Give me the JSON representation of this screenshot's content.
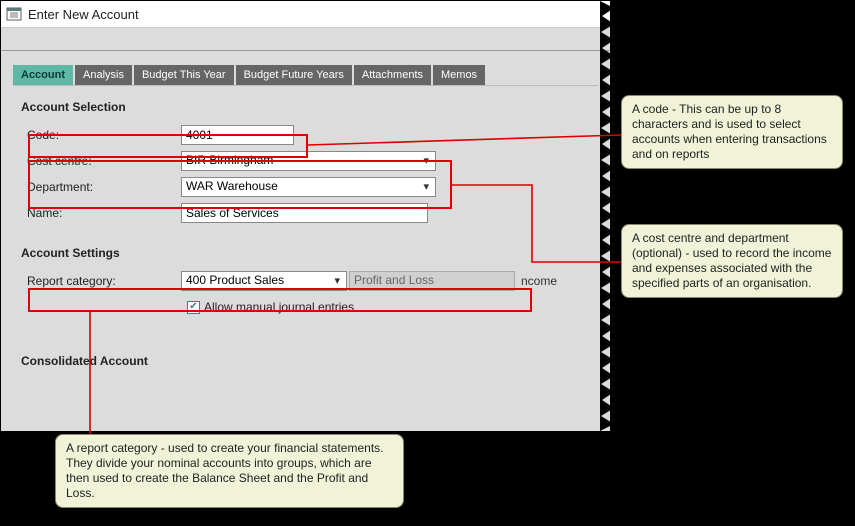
{
  "window": {
    "title": "Enter New Account"
  },
  "tabs": {
    "account": "Account",
    "analysis": "Analysis",
    "budget_this_year": "Budget This Year",
    "budget_future_years": "Budget Future Years",
    "attachments": "Attachments",
    "memos": "Memos"
  },
  "sections": {
    "selection": "Account Selection",
    "settings": "Account Settings",
    "consolidated": "Consolidated Account"
  },
  "labels": {
    "code": "Code:",
    "cost_centre": "Cost centre:",
    "department": "Department:",
    "name": "Name:",
    "report_category": "Report category:",
    "allow_manual": "Allow manual journal entries"
  },
  "values": {
    "code": "4001",
    "cost_centre": "BIR Birmingham",
    "department": "WAR Warehouse",
    "name": "Sales of Services",
    "report_category": "400 Product Sales",
    "report_type": "Profit and Loss",
    "partial": "ncome",
    "allow_manual_checked": "✔"
  },
  "annotations": {
    "code": " A code - This can be up to 8 characters and is used to select accounts when entering transactions and on reports",
    "cc_dept": " A cost centre and department (optional) - used to record the income and expenses associated with the specified parts of an organisation.",
    "report_cat": " A report category - used to create your financial statements. They divide your nominal accounts into groups, which are then used to create the Balance Sheet and the Profit and Loss."
  }
}
